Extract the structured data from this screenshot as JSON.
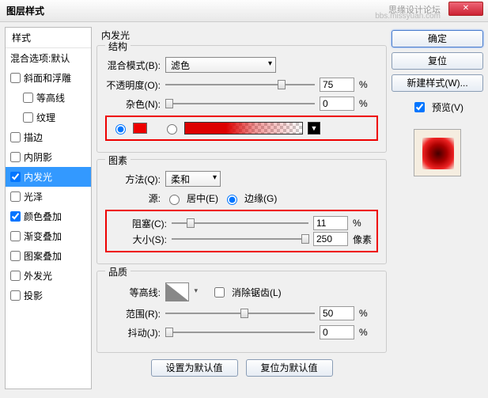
{
  "title": "图层样式",
  "watermark": "思缘设计论坛",
  "watermark2": "bbs.missyuan.com",
  "sidebar": {
    "header": "样式",
    "items": [
      {
        "label": "混合选项:默认",
        "checked": null
      },
      {
        "label": "斜面和浮雕",
        "checked": false
      },
      {
        "label": "等高线",
        "checked": false,
        "sub": true
      },
      {
        "label": "纹理",
        "checked": false,
        "sub": true
      },
      {
        "label": "描边",
        "checked": false
      },
      {
        "label": "内阴影",
        "checked": false
      },
      {
        "label": "内发光",
        "checked": true,
        "selected": true
      },
      {
        "label": "光泽",
        "checked": false
      },
      {
        "label": "颜色叠加",
        "checked": true
      },
      {
        "label": "渐变叠加",
        "checked": false
      },
      {
        "label": "图案叠加",
        "checked": false
      },
      {
        "label": "外发光",
        "checked": false
      },
      {
        "label": "投影",
        "checked": false
      }
    ]
  },
  "panel": {
    "title": "内发光",
    "structure": {
      "legend": "结构",
      "blend": {
        "label": "混合模式(B):",
        "value": "滤色"
      },
      "opacity": {
        "label": "不透明度(O):",
        "value": "75",
        "unit": "%"
      },
      "noise": {
        "label": "杂色(N):",
        "value": "0",
        "unit": "%"
      },
      "color_solid": "#e00",
      "grad_checked": false
    },
    "elements": {
      "legend": "图素",
      "method": {
        "label": "方法(Q):",
        "value": "柔和"
      },
      "source": {
        "label": "源:",
        "center": "居中(E)",
        "edge": "边缘(G)",
        "sel": "edge"
      },
      "choke": {
        "label": "阻塞(C):",
        "value": "11",
        "unit": "%"
      },
      "size": {
        "label": "大小(S):",
        "value": "250",
        "unit": "像素"
      }
    },
    "quality": {
      "legend": "品质",
      "contour": {
        "label": "等高线:",
        "anti": "消除锯齿(L)"
      },
      "range": {
        "label": "范围(R):",
        "value": "50",
        "unit": "%"
      },
      "jitter": {
        "label": "抖动(J):",
        "value": "0",
        "unit": "%"
      }
    },
    "defaults": {
      "set": "设置为默认值",
      "reset": "复位为默认值"
    }
  },
  "buttons": {
    "ok": "确定",
    "cancel": "复位",
    "newstyle": "新建样式(W)...",
    "preview": "预览(V)"
  }
}
